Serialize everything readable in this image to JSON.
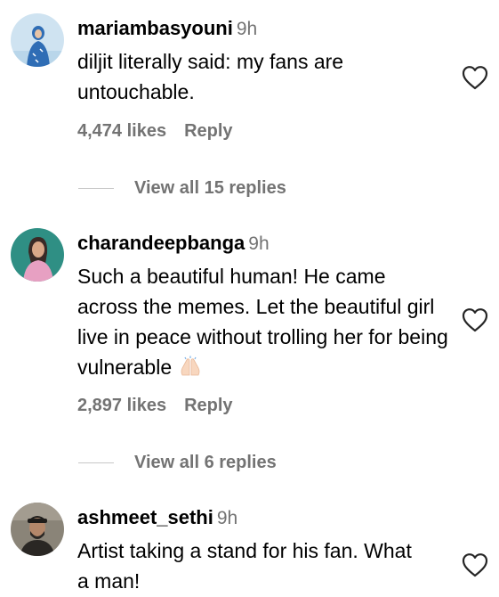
{
  "comments": [
    {
      "username": "mariambasyouni",
      "time": "9h",
      "text": "diljit literally said: my fans are untouchable.",
      "likes": "4,474 likes",
      "reply_label": "Reply",
      "view_replies": "View all 15 replies",
      "avatar_colors": {
        "bg": "#cfe3f1",
        "figure": "#2f6db5"
      }
    },
    {
      "username": "charandeepbanga",
      "time": "9h",
      "text": "Such a beautiful human! He came across the memes. Let the beautiful girl live in peace without trolling her for being vulnerable",
      "emoji": "folded-hands-emoji",
      "likes": "2,897 likes",
      "reply_label": "Reply",
      "view_replies": "View all 6 replies",
      "avatar_colors": {
        "bg": "#2f8f84",
        "figure": "#e7a0c2"
      }
    },
    {
      "username": "ashmeet_sethi",
      "time": "9h",
      "text": "Artist taking a stand for his fan. What a man!",
      "avatar_colors": {
        "bg": "#8a8478",
        "figure": "#2a2724"
      }
    }
  ],
  "icons": {
    "like": "heart-outline-icon"
  },
  "colors": {
    "meta_text": "#737373",
    "divider": "#c7c7c7",
    "text": "#000000"
  }
}
